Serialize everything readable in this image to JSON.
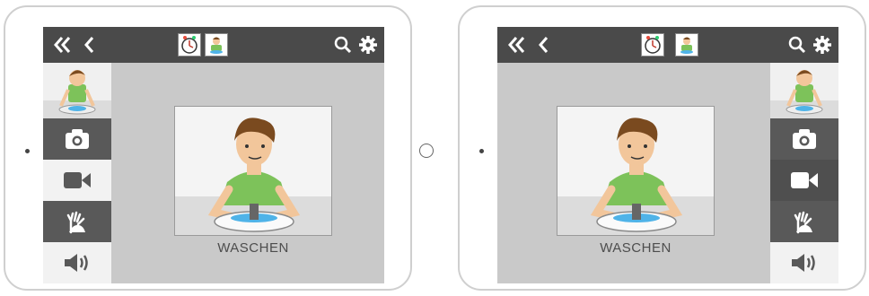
{
  "devices": [
    {
      "orientation_note": "sidebar-left",
      "card_label": "WASCHEN",
      "icons": {
        "back_double": "double-chevron-left-icon",
        "back": "chevron-left-icon",
        "search": "search-icon",
        "settings": "gear-icon",
        "camera": "camera-icon",
        "video": "video-icon",
        "sign": "sign-hands-icon",
        "audio": "speaker-icon"
      }
    },
    {
      "orientation_note": "sidebar-right",
      "card_label": "WASCHEN",
      "icons": {
        "back_double": "double-chevron-left-icon",
        "back": "chevron-left-icon",
        "search": "search-icon",
        "settings": "gear-icon",
        "camera": "camera-icon",
        "video": "video-icon",
        "sign": "sign-hands-icon",
        "audio": "speaker-icon"
      }
    }
  ],
  "colors": {
    "topbar": "#4a4a4a",
    "sidebar_dark": "#595959",
    "screen_bg": "#c9c9c9",
    "shirt": "#7dc25a",
    "hair": "#7a4a1f",
    "water": "#4fb3e8"
  }
}
